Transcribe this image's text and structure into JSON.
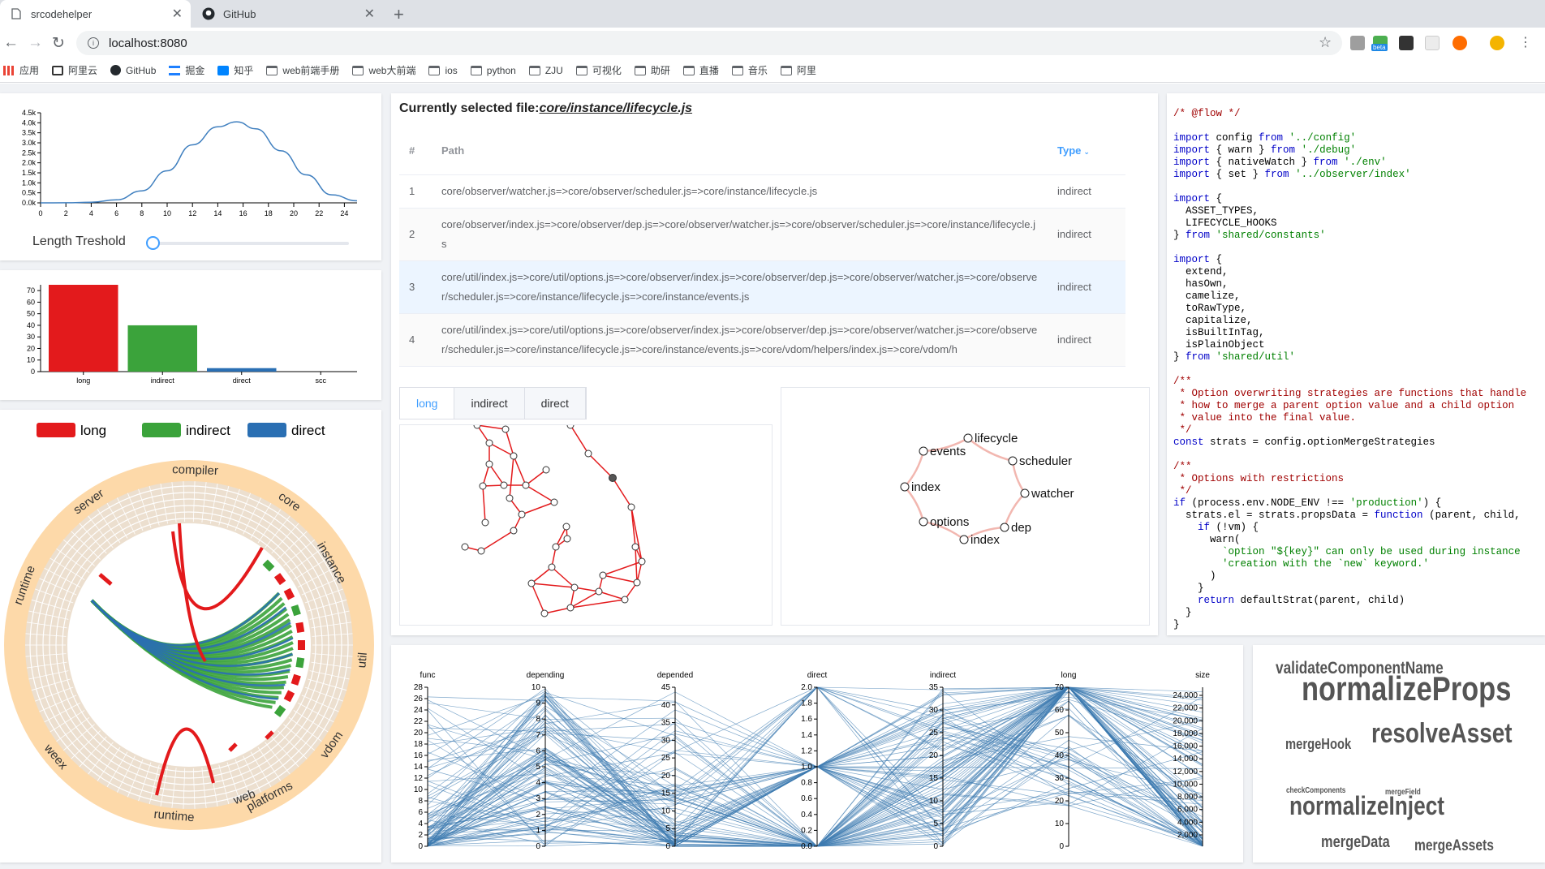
{
  "browser": {
    "tabs": [
      {
        "title": "srcodehelper",
        "active": true
      },
      {
        "title": "GitHub",
        "active": false
      }
    ],
    "url": "localhost:8080",
    "bookmarks": [
      "应用",
      "阿里云",
      "GitHub",
      "掘金",
      "知乎",
      "web前端手册",
      "web大前端",
      "ios",
      "python",
      "ZJU",
      "可视化",
      "助研",
      "直播",
      "音乐",
      "阿里"
    ],
    "ext_badge": "beta"
  },
  "colors": {
    "long": "#e31a1c",
    "indirect": "#3ba33b",
    "direct": "#2a6fb3",
    "accent": "#409eff",
    "ring": "#fdd9a9",
    "ring_inner": "#ecdfcf"
  },
  "length_filter": {
    "label": "Length Treshold",
    "y_ticks": [
      "4.5k",
      "4.0k",
      "3.5k",
      "3.0k",
      "2.5k",
      "2.0k",
      "1.5k",
      "1.0k",
      "0.5k",
      "0.0k"
    ],
    "x_ticks": [
      "0",
      "2",
      "4",
      "6",
      "8",
      "10",
      "12",
      "14",
      "16",
      "18",
      "20",
      "22",
      "24"
    ]
  },
  "chart_data": [
    {
      "type": "bar",
      "categories": [
        "long",
        "indirect",
        "direct",
        "scc"
      ],
      "values": [
        75,
        40,
        3,
        0
      ],
      "ylim": [
        0,
        75
      ],
      "y_ticks": [
        "70",
        "60",
        "50",
        "40",
        "30",
        "20",
        "10",
        "0"
      ]
    },
    {
      "type": "area",
      "x": [
        0,
        2,
        4,
        6,
        8,
        10,
        12,
        14,
        15.5,
        17,
        19,
        21,
        23,
        25
      ],
      "values": [
        0,
        5,
        30,
        150,
        600,
        1600,
        2900,
        3800,
        4050,
        3700,
        2600,
        1400,
        400,
        100
      ],
      "ylim": [
        0,
        4500
      ]
    }
  ],
  "legend": {
    "long": "long",
    "indirect": "indirect",
    "direct": "direct"
  },
  "radial": {
    "labels": [
      "compiler",
      "core",
      "instance",
      "util",
      "vdom",
      "platforms",
      "web",
      "runtime",
      "weex",
      "runtime",
      "server"
    ]
  },
  "selected": {
    "prefix": "Currently selected file:",
    "file": "core/instance/lifecycle.js"
  },
  "table": {
    "headers": {
      "num": "#",
      "path": "Path",
      "type": "Type"
    },
    "rows": [
      {
        "num": "1",
        "path": "core/observer/watcher.js=>core/observer/scheduler.js=>core/instance/lifecycle.js",
        "type": "indirect"
      },
      {
        "num": "2",
        "path": "core/observer/index.js=>core/observer/dep.js=>core/observer/watcher.js=>core/observer/scheduler.js=>core/instance/lifecycle.js",
        "type": "indirect"
      },
      {
        "num": "3",
        "path": "core/util/index.js=>core/util/options.js=>core/observer/index.js=>core/observer/dep.js=>core/observer/watcher.js=>core/observer/scheduler.js=>core/instance/lifecycle.js=>core/instance/events.js",
        "type": "indirect"
      },
      {
        "num": "4",
        "path": "core/util/index.js=>core/util/options.js=>core/observer/index.js=>core/observer/dep.js=>core/observer/watcher.js=>core/observer/scheduler.js=>core/instance/lifecycle.js=>core/instance/events.js=>core/vdom/helpers/index.js=>core/vdom/h",
        "type": "indirect"
      }
    ]
  },
  "graph_tabs": [
    "long",
    "indirect",
    "direct"
  ],
  "cycle_nodes": [
    "lifecycle",
    "scheduler",
    "watcher",
    "dep",
    "index",
    "options",
    "index",
    "events"
  ],
  "parallel": {
    "axes": [
      "func",
      "depending",
      "depended",
      "direct",
      "indirect",
      "long",
      "size"
    ]
  },
  "code": {
    "lines": [
      [
        [
          "cm",
          "/* @flow */"
        ]
      ],
      [],
      [
        [
          "kw",
          "import"
        ],
        [
          "",
          " config "
        ],
        [
          "kw",
          "from"
        ],
        [
          "",
          " "
        ],
        [
          "str",
          "'../config'"
        ]
      ],
      [
        [
          "kw",
          "import"
        ],
        [
          "",
          " { warn } "
        ],
        [
          "kw",
          "from"
        ],
        [
          "",
          " "
        ],
        [
          "str",
          "'./debug'"
        ]
      ],
      [
        [
          "kw",
          "import"
        ],
        [
          "",
          " { nativeWatch } "
        ],
        [
          "kw",
          "from"
        ],
        [
          "",
          " "
        ],
        [
          "str",
          "'./env'"
        ]
      ],
      [
        [
          "kw",
          "import"
        ],
        [
          "",
          " { set } "
        ],
        [
          "kw",
          "from"
        ],
        [
          "",
          " "
        ],
        [
          "str",
          "'../observer/index'"
        ]
      ],
      [],
      [
        [
          "kw",
          "import"
        ],
        [
          "",
          " {"
        ]
      ],
      [
        [
          "",
          "  ASSET_TYPES,"
        ]
      ],
      [
        [
          "",
          "  LIFECYCLE_HOOKS"
        ]
      ],
      [
        [
          "",
          "} "
        ],
        [
          "kw",
          "from"
        ],
        [
          "",
          " "
        ],
        [
          "str",
          "'shared/constants'"
        ]
      ],
      [],
      [
        [
          "kw",
          "import"
        ],
        [
          "",
          " {"
        ]
      ],
      [
        [
          "",
          "  extend,"
        ]
      ],
      [
        [
          "",
          "  hasOwn,"
        ]
      ],
      [
        [
          "",
          "  camelize,"
        ]
      ],
      [
        [
          "",
          "  toRawType,"
        ]
      ],
      [
        [
          "",
          "  capitalize,"
        ]
      ],
      [
        [
          "",
          "  isBuiltInTag,"
        ]
      ],
      [
        [
          "",
          "  isPlainObject"
        ]
      ],
      [
        [
          "",
          "} "
        ],
        [
          "kw",
          "from"
        ],
        [
          "",
          " "
        ],
        [
          "str",
          "'shared/util'"
        ]
      ],
      [],
      [
        [
          "cm",
          "/**"
        ]
      ],
      [
        [
          "cm",
          " * Option overwriting strategies are functions that handle"
        ]
      ],
      [
        [
          "cm",
          " * how to merge a parent option value and a child option"
        ]
      ],
      [
        [
          "cm",
          " * value into the final value."
        ]
      ],
      [
        [
          "cm",
          " */"
        ]
      ],
      [
        [
          "kw",
          "const"
        ],
        [
          "",
          " strats = config.optionMergeStrategies"
        ]
      ],
      [],
      [
        [
          "cm",
          "/**"
        ]
      ],
      [
        [
          "cm",
          " * Options with restrictions"
        ]
      ],
      [
        [
          "cm",
          " */"
        ]
      ],
      [
        [
          "kw",
          "if"
        ],
        [
          "",
          " (process.env.NODE_ENV !== "
        ],
        [
          "str",
          "'production'"
        ],
        [
          "",
          ") {"
        ]
      ],
      [
        [
          "",
          "  strats.el = strats.propsData = "
        ],
        [
          "kw",
          "function"
        ],
        [
          "",
          " (parent, child,"
        ]
      ],
      [
        [
          "",
          "    "
        ],
        [
          "kw",
          "if"
        ],
        [
          "",
          " (!vm) {"
        ]
      ],
      [
        [
          "",
          "      warn("
        ]
      ],
      [
        [
          "",
          "        "
        ],
        [
          "str",
          "`option \"${key}\" can only be used during instance"
        ]
      ],
      [
        [
          "",
          "        "
        ],
        [
          "str",
          "'creation with the `new` keyword.'"
        ]
      ],
      [
        [
          "",
          "      )"
        ]
      ],
      [
        [
          "",
          "    }"
        ]
      ],
      [
        [
          "",
          "    "
        ],
        [
          "kw",
          "return"
        ],
        [
          "",
          " defaultStrat(parent, child)"
        ]
      ],
      [
        [
          "",
          "  }"
        ]
      ],
      [
        [
          "",
          "}"
        ]
      ]
    ]
  },
  "wordcloud": [
    {
      "text": "validateComponentName",
      "size": 21
    },
    {
      "text": "normalizeProps",
      "size": 42
    },
    {
      "text": "mergeHook",
      "size": 18
    },
    {
      "text": "resolveAsset",
      "size": 34
    },
    {
      "text": "checkComponents",
      "size": 10
    },
    {
      "text": "mergeField",
      "size": 10
    },
    {
      "text": "normalizeInject",
      "size": 32
    },
    {
      "text": "mergeData",
      "size": 20
    },
    {
      "text": "mergeAssets",
      "size": 19
    }
  ]
}
